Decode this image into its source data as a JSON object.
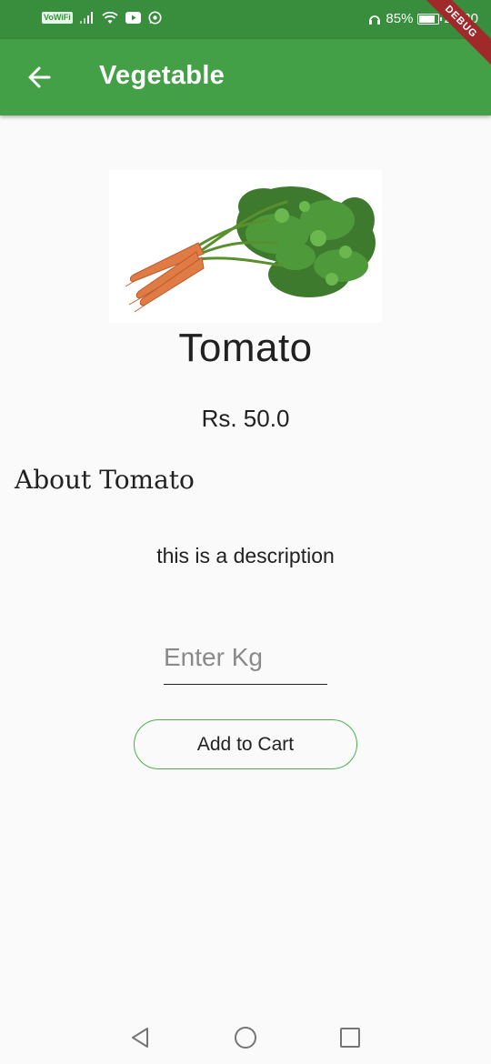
{
  "status_bar": {
    "network_badge": "VoWiFi",
    "battery": "85%",
    "battery_level": 0.85,
    "time": "22:30"
  },
  "app_bar": {
    "title": "Vegetable",
    "color": "#43a047",
    "status_color": "#388e3c"
  },
  "debug_banner": "DEBUG",
  "product": {
    "image": "carrot-bunch",
    "name": "Tomato",
    "price": "Rs. 50.0",
    "about_heading": "About Tomato",
    "description": "this is a description"
  },
  "form": {
    "kg_placeholder": "Enter Kg",
    "kg_value": "",
    "add_to_cart_label": "Add to Cart",
    "button_border_color": "#4caf50"
  },
  "nav_bar": {
    "icons": [
      "back-triangle-icon",
      "home-circle-icon",
      "recents-square-icon"
    ]
  }
}
